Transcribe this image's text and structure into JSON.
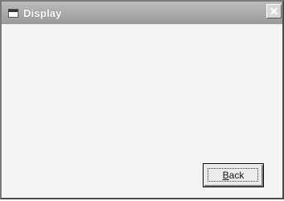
{
  "window": {
    "title": "Display",
    "close_glyph": "✕"
  },
  "buttons": {
    "back_label": "Back"
  }
}
